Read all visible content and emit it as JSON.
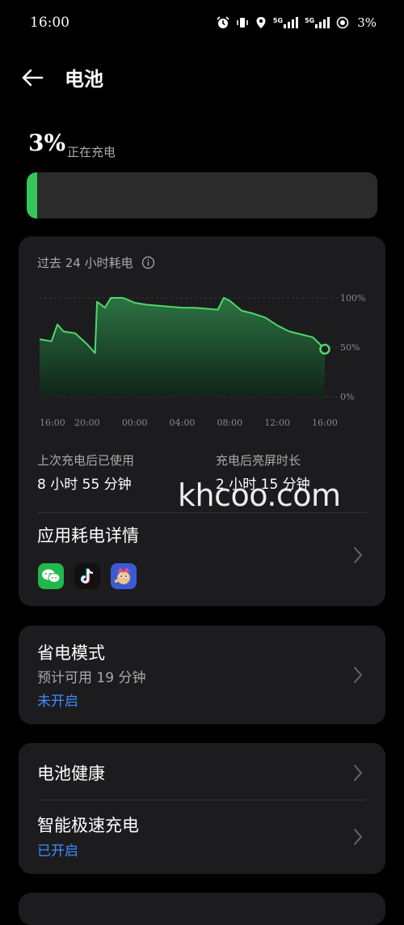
{
  "status_bar": {
    "time": "16:00",
    "battery_percent": "3%",
    "icons": [
      "alarm-icon",
      "vibrate-icon",
      "location-icon",
      "signal-5g-icon",
      "signal-5g-icon",
      "battery-icon"
    ],
    "network_labels": [
      "5G",
      "5G"
    ]
  },
  "header": {
    "title": "电池",
    "back_icon": "arrow-left-icon"
  },
  "battery": {
    "percent_label": "3%",
    "status": "正在充电",
    "level_fraction": 0.03,
    "fill_color": "#34c759"
  },
  "usage_card": {
    "title": "过去 24 小时耗电",
    "info_icon": "info-icon",
    "chart_data": {
      "type": "area",
      "x": [
        "16:00",
        "17:00",
        "17:30",
        "18:00",
        "19:00",
        "20:00",
        "20:40",
        "20:50",
        "21:30",
        "22:00",
        "23:00",
        "00:00",
        "01:00",
        "02:00",
        "03:00",
        "04:00",
        "05:00",
        "06:00",
        "07:00",
        "07:30",
        "08:00",
        "09:00",
        "10:00",
        "11:00",
        "12:00",
        "13:00",
        "14:00",
        "15:00",
        "15:30",
        "16:00"
      ],
      "y": [
        58,
        56,
        73,
        66,
        64,
        53,
        44,
        96,
        90,
        100,
        100,
        95,
        93,
        92,
        91,
        90,
        90,
        89,
        88,
        100,
        97,
        87,
        84,
        80,
        72,
        66,
        63,
        60,
        54,
        48
      ],
      "x_ticks": [
        "16:00",
        "20:00",
        "00:00",
        "04:00",
        "08:00",
        "12:00",
        "16:00"
      ],
      "y_ticks": [
        "100%",
        "50%",
        "0%"
      ],
      "ylim": [
        0,
        100
      ],
      "line_color": "#4cd96a",
      "fill_color": "#1f4a2a",
      "grid": true
    },
    "stats": [
      {
        "label": "上次充电后已使用",
        "value": "8 小时 55 分钟"
      },
      {
        "label": "充电后亮屏时长",
        "value": "2 小时 15 分钟"
      }
    ],
    "app_usage": {
      "title": "应用耗电详情",
      "apps": [
        "wechat-icon",
        "tiktok-icon",
        "game-icon"
      ]
    }
  },
  "power_saving": {
    "title": "省电模式",
    "estimate": "预计可用 19 分钟",
    "status": "未开启"
  },
  "battery_health": {
    "title": "电池健康"
  },
  "fast_charge": {
    "title": "智能极速充电",
    "status": "已开启"
  },
  "watermark": "khcoo.com"
}
